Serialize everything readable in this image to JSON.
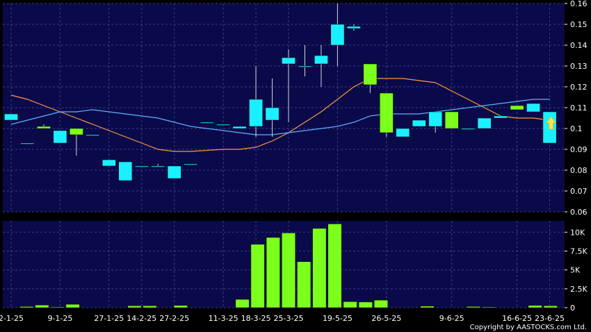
{
  "chart_data": [
    {
      "type": "candlestick",
      "dates": [
        "2-1-25",
        "9-1-25",
        "27-1-25",
        "14-2-25",
        "27-2-25",
        "11-3-25",
        "18-3-25",
        "25-3-25",
        "19-5-25",
        "26-5-25",
        "9-6-25",
        "16-6-25",
        "23-6-25"
      ],
      "x_tick_labels": [
        "2-1-25",
        "9-1-25",
        "27-1-25",
        "14-2-25",
        "27-2-25",
        "11-3-25",
        "18-3-25",
        "25-3-25",
        "19-5-25",
        "26-5-25",
        "9-6-25",
        "16-6-25",
        "23-6-25"
      ],
      "ylim": [
        0.06,
        0.16
      ],
      "y_ticks": [
        "0.06",
        "0.07",
        "0.08",
        "0.09",
        "0.1",
        "0.11",
        "0.12",
        "0.13",
        "0.14",
        "0.15",
        "0.16"
      ],
      "grid": true,
      "candles": [
        {
          "open": 0.107,
          "close": 0.104,
          "high": 0.107,
          "low": 0.104,
          "color": "cyan"
        },
        {
          "open": 0.093,
          "close": 0.093,
          "high": 0.093,
          "low": 0.093,
          "color": "cyan"
        },
        {
          "open": 0.1,
          "close": 0.101,
          "high": 0.102,
          "low": 0.1,
          "color": "green"
        },
        {
          "open": 0.099,
          "close": 0.093,
          "high": 0.099,
          "low": 0.093,
          "color": "cyan"
        },
        {
          "open": 0.097,
          "close": 0.1,
          "high": 0.1,
          "low": 0.087,
          "color": "green"
        },
        {
          "open": 0.097,
          "close": 0.097,
          "high": 0.097,
          "low": 0.097,
          "color": "cyan"
        },
        {
          "open": 0.085,
          "close": 0.082,
          "high": 0.085,
          "low": 0.082,
          "color": "cyan"
        },
        {
          "open": 0.084,
          "close": 0.075,
          "high": 0.084,
          "low": 0.075,
          "color": "cyan"
        },
        {
          "open": 0.082,
          "close": 0.082,
          "high": 0.082,
          "low": 0.082,
          "color": "cyan"
        },
        {
          "open": 0.082,
          "close": 0.082,
          "high": 0.083,
          "low": 0.082,
          "color": "cyan"
        },
        {
          "open": 0.082,
          "close": 0.076,
          "high": 0.082,
          "low": 0.076,
          "color": "cyan"
        },
        {
          "open": 0.083,
          "close": 0.083,
          "high": 0.083,
          "low": 0.083,
          "color": "cyan"
        },
        {
          "open": 0.103,
          "close": 0.103,
          "high": 0.103,
          "low": 0.103,
          "color": "cyan"
        },
        {
          "open": 0.102,
          "close": 0.102,
          "high": 0.102,
          "low": 0.102,
          "color": "cyan"
        },
        {
          "open": 0.101,
          "close": 0.1,
          "high": 0.101,
          "low": 0.1,
          "color": "cyan"
        },
        {
          "open": 0.114,
          "close": 0.101,
          "high": 0.13,
          "low": 0.096,
          "color": "cyan"
        },
        {
          "open": 0.11,
          "close": 0.104,
          "high": 0.124,
          "low": 0.096,
          "color": "cyan"
        },
        {
          "open": 0.134,
          "close": 0.131,
          "high": 0.138,
          "low": 0.103,
          "color": "cyan"
        },
        {
          "open": 0.13,
          "close": 0.13,
          "high": 0.14,
          "low": 0.125,
          "color": "cyan"
        },
        {
          "open": 0.135,
          "close": 0.131,
          "high": 0.14,
          "low": 0.12,
          "color": "cyan"
        },
        {
          "open": 0.15,
          "close": 0.14,
          "high": 0.16,
          "low": 0.13,
          "color": "cyan"
        },
        {
          "open": 0.149,
          "close": 0.148,
          "high": 0.15,
          "low": 0.147,
          "color": "cyan"
        },
        {
          "open": 0.121,
          "close": 0.131,
          "high": 0.131,
          "low": 0.117,
          "color": "green"
        },
        {
          "open": 0.098,
          "close": 0.117,
          "high": 0.117,
          "low": 0.096,
          "color": "green"
        },
        {
          "open": 0.1,
          "close": 0.096,
          "high": 0.1,
          "low": 0.096,
          "color": "cyan"
        },
        {
          "open": 0.104,
          "close": 0.101,
          "high": 0.104,
          "low": 0.101,
          "color": "cyan"
        },
        {
          "open": 0.108,
          "close": 0.101,
          "high": 0.108,
          "low": 0.098,
          "color": "cyan"
        },
        {
          "open": 0.1,
          "close": 0.108,
          "high": 0.108,
          "low": 0.1,
          "color": "green"
        },
        {
          "open": 0.1,
          "close": 0.1,
          "high": 0.1,
          "low": 0.1,
          "color": "cyan"
        },
        {
          "open": 0.105,
          "close": 0.1,
          "high": 0.105,
          "low": 0.1,
          "color": "cyan"
        },
        {
          "open": 0.106,
          "close": 0.105,
          "high": 0.106,
          "low": 0.105,
          "color": "cyan"
        },
        {
          "open": 0.109,
          "close": 0.111,
          "high": 0.111,
          "low": 0.109,
          "color": "green"
        },
        {
          "open": 0.112,
          "close": 0.108,
          "high": 0.112,
          "low": 0.108,
          "color": "cyan"
        },
        {
          "open": 0.108,
          "close": 0.093,
          "high": 0.108,
          "low": 0.093,
          "color": "cyan"
        }
      ],
      "series": [
        {
          "color": "#ff9a3c",
          "values": [
            0.116,
            0.114,
            0.111,
            0.108,
            0.105,
            0.102,
            0.099,
            0.096,
            0.093,
            0.09,
            0.089,
            0.089,
            0.0895,
            0.09,
            0.09,
            0.091,
            0.094,
            0.098,
            0.103,
            0.108,
            0.114,
            0.12,
            0.124,
            0.124,
            0.124,
            0.123,
            0.122,
            0.118,
            0.114,
            0.11,
            0.106,
            0.105,
            0.105,
            0.104
          ]
        },
        {
          "color": "#5ab4ff",
          "values": [
            0.102,
            0.104,
            0.106,
            0.108,
            0.108,
            0.109,
            0.108,
            0.107,
            0.106,
            0.105,
            0.103,
            0.101,
            0.1,
            0.099,
            0.098,
            0.097,
            0.097,
            0.098,
            0.099,
            0.1,
            0.101,
            0.103,
            0.106,
            0.107,
            0.107,
            0.107,
            0.108,
            0.109,
            0.11,
            0.111,
            0.112,
            0.113,
            0.114,
            0.114
          ]
        }
      ]
    },
    {
      "type": "bar",
      "ylim": [
        0,
        11500
      ],
      "y_ticks": [
        "0",
        "2.5K",
        "5K",
        "7.5K",
        "10K"
      ],
      "grid": true,
      "values": [
        0,
        150,
        350,
        100,
        450,
        0,
        0,
        0,
        250,
        250,
        0,
        300,
        0,
        0,
        0,
        1100,
        8400,
        9300,
        9900,
        6100,
        10500,
        11100,
        800,
        750,
        1000,
        0,
        0,
        200,
        0,
        0,
        150,
        100,
        0,
        0,
        300,
        250
      ]
    }
  ],
  "arrow_icon": "up-arrow-icon",
  "arrow_color": "#ffe24a",
  "copyright": "Copyright by AASTOCKS.com Ltd."
}
